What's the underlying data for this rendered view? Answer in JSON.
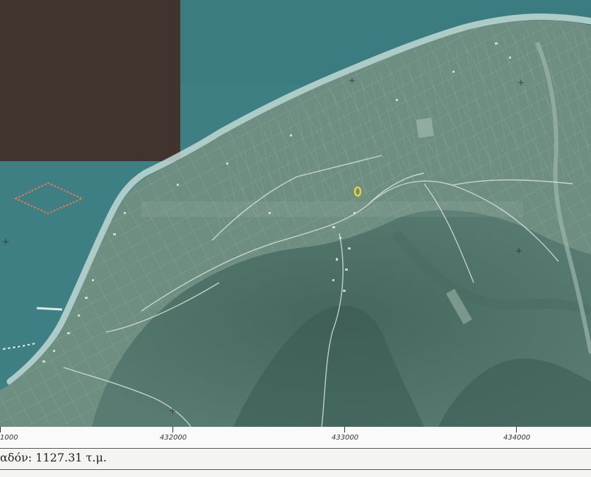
{
  "map": {
    "colors": {
      "sea": "#3e7f83",
      "sea_deep": "#356f74",
      "beach": "#b9d2cf",
      "land_plain": "#6f8e82",
      "land_hills": "#4f7168",
      "dark_patch": "#3d302c",
      "parcel_outline": "#e07858",
      "marker": "#f2d22a"
    },
    "marker_icon": "location-marker-icon",
    "parcel_icon": "diamond-outline-icon"
  },
  "scale": {
    "ticks": [
      "1000",
      "432000",
      "433000",
      "434000"
    ]
  },
  "area_label": "αδόν: 1127.31 τ.μ."
}
